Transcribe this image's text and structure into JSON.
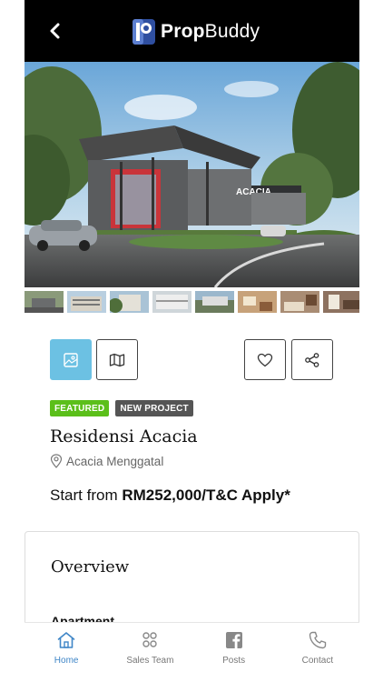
{
  "header": {
    "logo_bold": "Prop",
    "logo_light": "Buddy"
  },
  "property": {
    "badges": [
      "FEATURED",
      "NEW PROJECT"
    ],
    "name": "Residensi Acacia",
    "location": "Acacia Menggatal",
    "price_prefix": "Start from",
    "price_value": "RM252,000/T&C Apply*"
  },
  "hero": {
    "signage": "ACACIA"
  },
  "overview": {
    "title": "Overview",
    "subtitle": "Apartment"
  },
  "nav": {
    "items": [
      {
        "label": "Home",
        "icon": "home-icon",
        "active": true
      },
      {
        "label": "Sales Team",
        "icon": "team-icon",
        "active": false
      },
      {
        "label": "Posts",
        "icon": "facebook-icon",
        "active": false
      },
      {
        "label": "Contact",
        "icon": "phone-icon",
        "active": false
      }
    ]
  },
  "colors": {
    "accent": "#6cc1e3",
    "featured": "#5bbf1a",
    "nav_active": "#3f86c7"
  }
}
